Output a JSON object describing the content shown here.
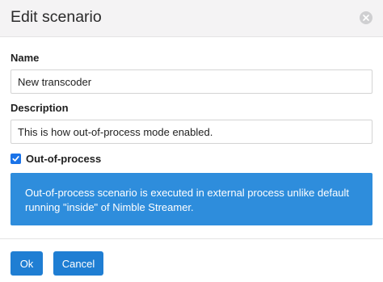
{
  "dialog": {
    "title": "Edit scenario",
    "close_icon": "close-circle-icon"
  },
  "form": {
    "name_label": "Name",
    "name_value": "New transcoder",
    "description_label": "Description",
    "description_value": "This is how out-of-process mode enabled.",
    "out_of_process": {
      "label": "Out-of-process",
      "checked": true
    },
    "info_text": "Out-of-process scenario is executed in external process unlike default running \"inside\" of Nimble Streamer."
  },
  "footer": {
    "ok_label": "Ok",
    "cancel_label": "Cancel"
  },
  "colors": {
    "accent": "#1f7ed3",
    "info_bg": "#2e8ddc",
    "header_bg": "#f4f3f4"
  }
}
